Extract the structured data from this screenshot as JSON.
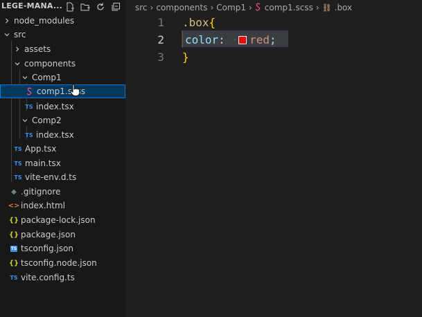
{
  "explorer": {
    "title": "LEGE-MANA...",
    "actions": [
      {
        "name": "new-file-icon"
      },
      {
        "name": "new-folder-icon"
      },
      {
        "name": "refresh-icon"
      },
      {
        "name": "collapse-all-icon"
      }
    ],
    "items": [
      {
        "label": "node_modules",
        "type": "folder",
        "expanded": false,
        "depth": 0,
        "icon": "chevron-right-icon"
      },
      {
        "label": "src",
        "type": "folder",
        "expanded": true,
        "depth": 0,
        "icon": "chevron-down-icon"
      },
      {
        "label": "assets",
        "type": "folder",
        "expanded": false,
        "depth": 1,
        "icon": "chevron-right-icon"
      },
      {
        "label": "components",
        "type": "folder",
        "expanded": true,
        "depth": 1,
        "icon": "chevron-down-icon"
      },
      {
        "label": "Comp1",
        "type": "folder",
        "expanded": true,
        "depth": 2,
        "icon": "chevron-down-icon"
      },
      {
        "label": "comp1.scss",
        "type": "file",
        "depth": 3,
        "icon": "scss-file-icon",
        "selected": true
      },
      {
        "label": "index.tsx",
        "type": "file",
        "depth": 3,
        "icon": "ts-file-icon"
      },
      {
        "label": "Comp2",
        "type": "folder",
        "expanded": true,
        "depth": 2,
        "icon": "chevron-down-icon"
      },
      {
        "label": "index.tsx",
        "type": "file",
        "depth": 3,
        "icon": "ts-file-icon"
      },
      {
        "label": "App.tsx",
        "type": "file",
        "depth": 1,
        "icon": "ts-file-icon"
      },
      {
        "label": "main.tsx",
        "type": "file",
        "depth": 1,
        "icon": "ts-file-icon"
      },
      {
        "label": "vite-env.d.ts",
        "type": "file",
        "depth": 1,
        "icon": "ts-file-icon"
      },
      {
        "label": ".gitignore",
        "type": "file",
        "depth": 0,
        "icon": "gitignore-file-icon"
      },
      {
        "label": "index.html",
        "type": "file",
        "depth": 0,
        "icon": "html-file-icon"
      },
      {
        "label": "package-lock.json",
        "type": "file",
        "depth": 0,
        "icon": "json-file-icon"
      },
      {
        "label": "package.json",
        "type": "file",
        "depth": 0,
        "icon": "json-file-icon"
      },
      {
        "label": "tsconfig.json",
        "type": "file",
        "depth": 0,
        "icon": "tsconfig-file-icon"
      },
      {
        "label": "tsconfig.node.json",
        "type": "file",
        "depth": 0,
        "icon": "json-file-icon"
      },
      {
        "label": "vite.config.ts",
        "type": "file",
        "depth": 0,
        "icon": "ts-file-icon"
      }
    ]
  },
  "breadcrumb": [
    {
      "label": "src",
      "icon": ""
    },
    {
      "label": "components",
      "icon": ""
    },
    {
      "label": "Comp1",
      "icon": ""
    },
    {
      "label": "comp1.scss",
      "icon": "scss-file-icon"
    },
    {
      "label": ".box",
      "icon": "selector-icon"
    }
  ],
  "editor": {
    "lines": [
      {
        "number": "1",
        "tokens": [
          {
            "text": ".box",
            "kind": "sel"
          },
          {
            "text": "{",
            "kind": "brace"
          }
        ]
      },
      {
        "number": "2",
        "tokens": [
          {
            "text": "color",
            "kind": "prop"
          },
          {
            "text": ": ",
            "kind": "punc"
          },
          {
            "text": "red",
            "kind": "val"
          },
          {
            "text": ";",
            "kind": "punc"
          }
        ],
        "swatch": "#ff0000",
        "active": true
      },
      {
        "number": "3",
        "tokens": [
          {
            "text": "}",
            "kind": "brace"
          }
        ]
      }
    ]
  },
  "colors": {
    "sidebar_bg": "#181818",
    "editor_bg": "#1f1f1f",
    "selection_bg": "#04395e",
    "selection_border": "#0078d4",
    "ts_blue": "#3b8eea",
    "json_yellow": "#cbcb41",
    "scss_pink": "#f55385",
    "html_orange": "#e37933"
  }
}
